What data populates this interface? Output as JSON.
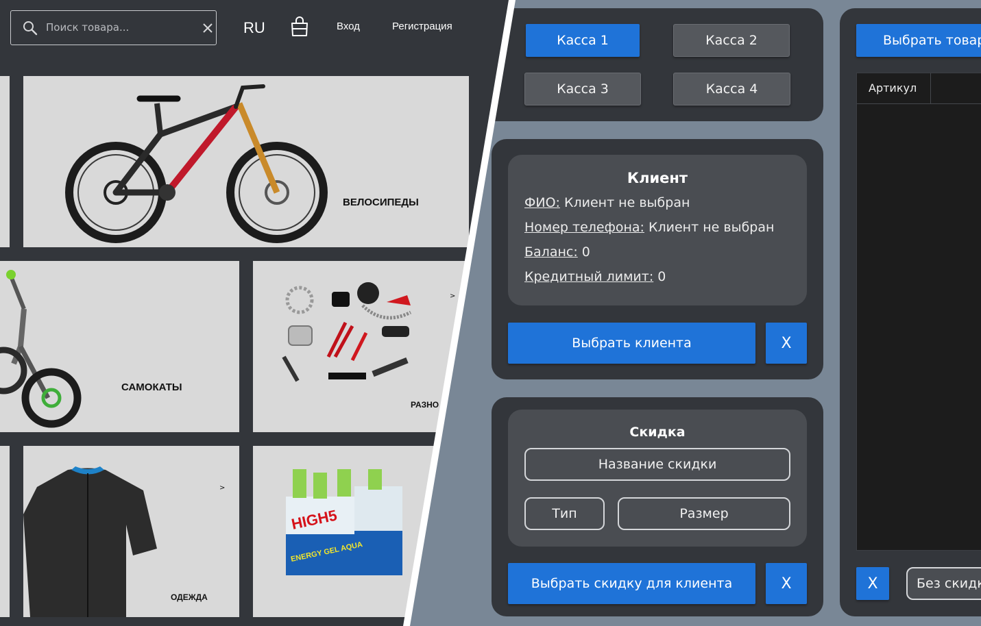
{
  "shop": {
    "search_placeholder": "Поиск товара...",
    "lang": "RU",
    "login": "Вход",
    "register": "Регистрация",
    "categories": {
      "bikes": "ВЕЛОСИПЕДЫ",
      "scooters": "САМОКАТЫ",
      "misc": "РАЗНО",
      "clothes": "ОДЕЖДА"
    },
    "arrow": ">",
    "gel_brand": "HIGH5",
    "gel_label": "ENERGY GEL AQUA"
  },
  "cashier": {
    "registers": [
      "Касса 1",
      "Касса 2",
      "Касса 3",
      "Касса 4"
    ],
    "active_register": "Касса 1",
    "client": {
      "title": "Клиент",
      "name_label": "ФИО:",
      "name_value": "Клиент не выбран",
      "phone_label": "Номер телефона:",
      "phone_value": "Клиент не выбран",
      "balance_label": "Баланс:",
      "balance_value": "0",
      "credit_label": "Кредитный лимит:",
      "credit_value": "0",
      "select_button": "Выбрать клиента",
      "clear_button": "X"
    },
    "discount": {
      "title": "Скидка",
      "name_button": "Название скидки",
      "type_button": "Тип",
      "size_button": "Размер",
      "select_button": "Выбрать скидку для клиента",
      "clear_button": "X"
    },
    "products": {
      "select_button": "Выбрать товар",
      "column_article": "Артикул",
      "clear_button": "X",
      "no_discount_button": "Без скидк"
    }
  },
  "colors": {
    "accent_blue": "#1f73d8",
    "panel_dark": "#33363b",
    "card_grey": "#4a4d52",
    "background_slate": "#798796"
  }
}
